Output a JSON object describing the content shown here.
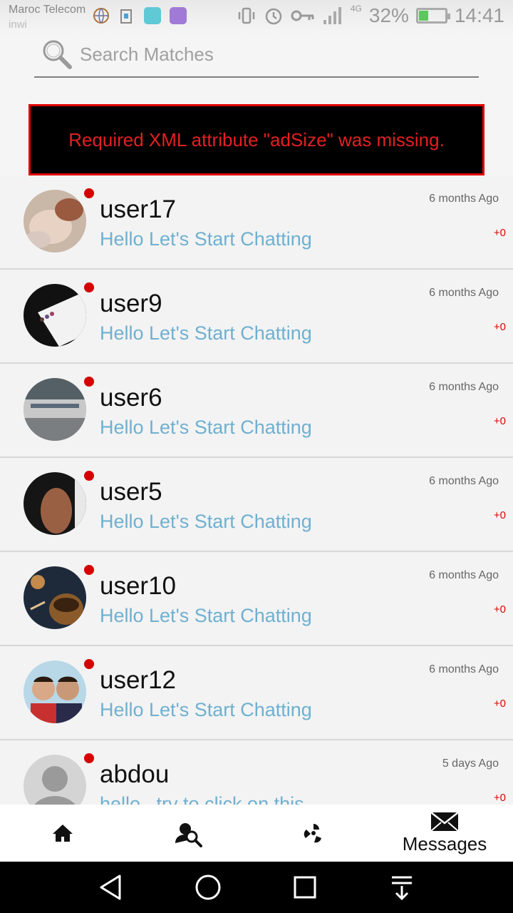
{
  "status_bar": {
    "carrier_primary": "Maroc Telecom",
    "carrier_secondary": "inwi",
    "network": "4G",
    "battery": "32%",
    "battery_level": 0.32,
    "time": "14:41"
  },
  "search": {
    "placeholder": "Search Matches"
  },
  "ad_error": {
    "message": "Required XML attribute \"adSize\" was missing."
  },
  "conversations": [
    {
      "name": "user17",
      "preview": "Hello Let's Start Chatting",
      "time": "6 months Ago",
      "unread": "+0"
    },
    {
      "name": "user9",
      "preview": "Hello Let's Start Chatting",
      "time": "6 months Ago",
      "unread": "+0"
    },
    {
      "name": "user6",
      "preview": "Hello Let's Start Chatting",
      "time": "6 months Ago",
      "unread": "+0"
    },
    {
      "name": "user5",
      "preview": "Hello Let's Start Chatting",
      "time": "6 months Ago",
      "unread": "+0"
    },
    {
      "name": "user10",
      "preview": "Hello Let's Start Chatting",
      "time": "6 months Ago",
      "unread": "+0"
    },
    {
      "name": "user12",
      "preview": "Hello Let's Start Chatting",
      "time": "6 months Ago",
      "unread": "+0"
    },
    {
      "name": "abdou",
      "preview": "hello , try to click on this",
      "time": "5 days Ago",
      "unread": "+0"
    }
  ],
  "bottom_nav": {
    "messages_label": "Messages"
  },
  "colors": {
    "accent_red": "#d40000",
    "preview_blue": "#6fb0d0"
  }
}
